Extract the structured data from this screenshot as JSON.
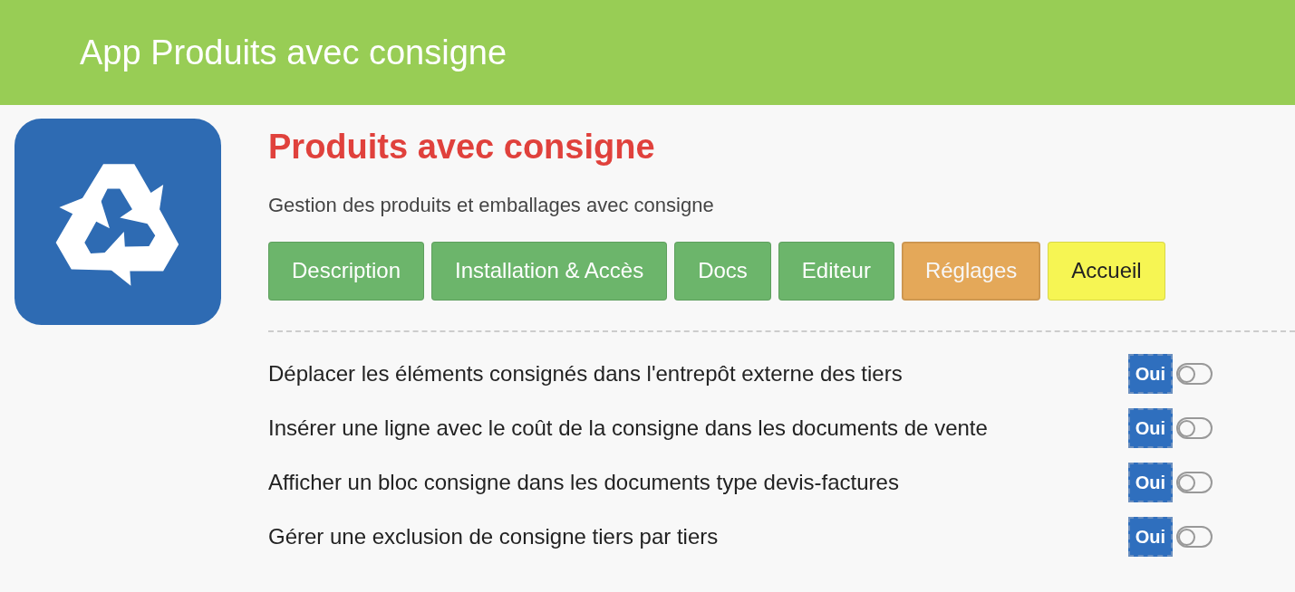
{
  "header": {
    "title": "App Produits avec consigne"
  },
  "app": {
    "title": "Produits avec consigne",
    "subtitle": "Gestion des produits et emballages avec consigne"
  },
  "buttons": [
    {
      "label": "Description",
      "color": "#6cb56b",
      "selected": false
    },
    {
      "label": "Installation & Accès",
      "color": "#6cb56b",
      "selected": false
    },
    {
      "label": "Docs",
      "color": "#6cb56b",
      "selected": false
    },
    {
      "label": "Editeur",
      "color": "#6cb56b",
      "selected": false
    },
    {
      "label": "Réglages",
      "color": "#ebad5c",
      "selected": true
    },
    {
      "label": "Accueil",
      "color": "#f6f553",
      "selected": false
    }
  ],
  "settings": [
    {
      "label": "Déplacer les éléments consignés dans l'entrepôt externe des tiers",
      "value": "Oui",
      "on": false
    },
    {
      "label": "Insérer une ligne avec le coût de la consigne dans les documents de vente",
      "value": "Oui",
      "on": false
    },
    {
      "label": "Afficher un bloc consigne dans les documents type devis-factures",
      "value": "Oui",
      "on": false
    },
    {
      "label": "Gérer une exclusion de consigne tiers par tiers",
      "value": "Oui",
      "on": false
    }
  ]
}
